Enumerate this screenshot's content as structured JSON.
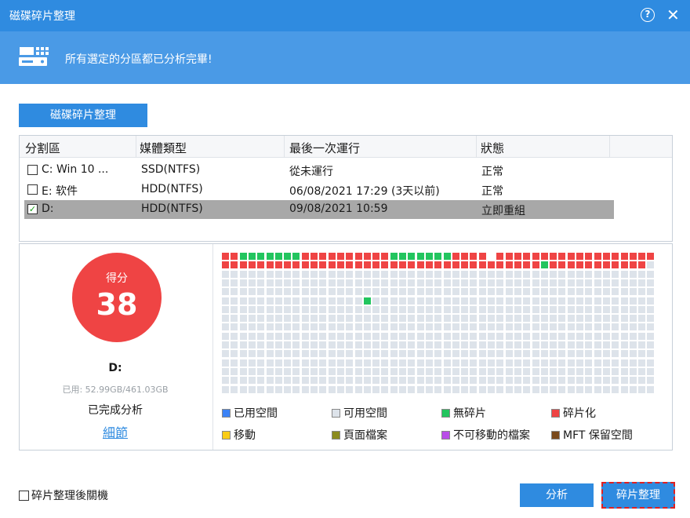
{
  "window": {
    "title": "磁碟碎片整理",
    "help_glyph": "?",
    "close_glyph": "✕"
  },
  "banner": {
    "message": "所有選定的分區都已分析完畢!"
  },
  "toolbar": {
    "defrag_label": "磁碟碎片整理"
  },
  "list": {
    "headers": [
      "分割區",
      "媒體類型",
      "最後一次運行",
      "狀態"
    ],
    "rows": [
      {
        "checked": false,
        "check_glyph": "",
        "partition": "C:  Win 10 ...",
        "media": "SSD(NTFS)",
        "last_run": "從未運行",
        "status": "正常"
      },
      {
        "checked": false,
        "check_glyph": "",
        "partition": "E:  软件",
        "media": "HDD(NTFS)",
        "last_run": "06/08/2021 17:29 (3天以前)",
        "status": "正常"
      },
      {
        "checked": true,
        "check_glyph": "✓",
        "partition": "D:",
        "media": "HDD(NTFS)",
        "last_run": "09/08/2021 10:59",
        "status": "立即重組"
      }
    ]
  },
  "score": {
    "label": "得分",
    "value": "38"
  },
  "drive": {
    "name": "D:",
    "usage": "已用: 52.99GB/461.03GB",
    "status": "已完成分析",
    "details_link": "細節"
  },
  "cluster_map": {
    "columns": 49,
    "rows": 16,
    "colors": {
      "used": "#3b82f6",
      "free": "#dde3ea",
      "contiguous": "#22c55e",
      "fragmented": "#ef4444",
      "moving": "#facc15",
      "pagefile": "#8b8b1e",
      "unmovable": "#b94de8",
      "mft": "#7a4a1c",
      "white": "#ffffff"
    },
    "row0": "FFGGGGGGGFFFFFFFFFFGGGGGGGFFFFWFFFFFFFFFFFFFFFFFF",
    "row1": "FFFFFFFFFFFFFFFFFFFFFFFFFFFFFFFFFFFFGFFFFFFFFFFFX",
    "extra_contiguous": {
      "row": 5,
      "col": 16
    }
  },
  "legend": [
    {
      "label": "已用空間",
      "color": "#3b82f6"
    },
    {
      "label": "可用空間",
      "color": "#dde3ea"
    },
    {
      "label": "無碎片",
      "color": "#22c55e"
    },
    {
      "label": "碎片化",
      "color": "#ef4444"
    },
    {
      "label": "移動",
      "color": "#facc15"
    },
    {
      "label": "頁面檔案",
      "color": "#8b8b1e"
    },
    {
      "label": "不可移動的檔案",
      "color": "#b94de8"
    },
    {
      "label": "MFT 保留空間",
      "color": "#7a4a1c"
    }
  ],
  "footer": {
    "shutdown_label": "碎片整理後關機",
    "analyze_label": "分析",
    "defrag_label": "碎片整理"
  }
}
